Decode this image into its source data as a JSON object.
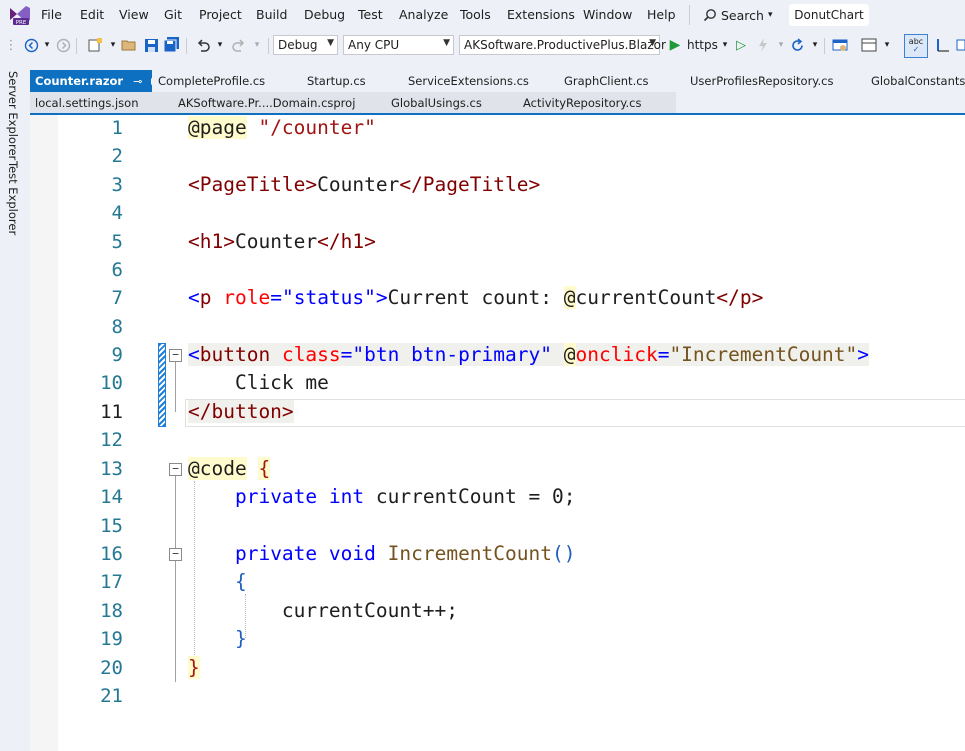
{
  "menubar": {
    "logo_badge": "PRE",
    "items": [
      "File",
      "Edit",
      "View",
      "Git",
      "Project",
      "Build",
      "Debug",
      "Test",
      "Analyze",
      "Tools",
      "Extensions",
      "Window",
      "Help"
    ],
    "search_label": "Search",
    "solution_name": "DonutChart"
  },
  "toolbar": {
    "config": "Debug",
    "platform": "Any CPU",
    "startup_project": "AKSoftware.ProductivePlus.Blazor",
    "run_label": "https"
  },
  "sidebar": {
    "items": [
      "Server Explorer",
      "Test Explorer"
    ]
  },
  "tabs": {
    "row1": [
      "Counter.razor",
      "CompleteProfile.cs",
      "Startup.cs",
      "ServiceExtensions.cs",
      "GraphClient.cs",
      "UserProfilesRepository.cs",
      "GlobalConstants.cs"
    ],
    "row2": [
      "local.settings.json",
      "AKSoftware.Pr....Domain.csproj",
      "GlobalUsings.cs",
      "ActivityRepository.cs"
    ],
    "active_pin": "⊸"
  },
  "editor": {
    "current_line": 11,
    "lines": [
      {
        "n": "1"
      },
      {
        "n": "2"
      },
      {
        "n": "3"
      },
      {
        "n": "4"
      },
      {
        "n": "5"
      },
      {
        "n": "6"
      },
      {
        "n": "7"
      },
      {
        "n": "8"
      },
      {
        "n": "9"
      },
      {
        "n": "10"
      },
      {
        "n": "11"
      },
      {
        "n": "12"
      },
      {
        "n": "13"
      },
      {
        "n": "14"
      },
      {
        "n": "15"
      },
      {
        "n": "16"
      },
      {
        "n": "17"
      },
      {
        "n": "18"
      },
      {
        "n": "19"
      },
      {
        "n": "20"
      },
      {
        "n": "21"
      }
    ],
    "tokens": {
      "l1_dir": "@page",
      "l1_str": "\"/counter\"",
      "l3_open": "<PageTitle>",
      "l3_text": "Counter",
      "l3_close": "</PageTitle>",
      "l5_open": "<h1>",
      "l5_text": "Counter",
      "l5_close": "</h1>",
      "l7_lt": "<",
      "l7_tag": "p",
      "l7_attr": "role",
      "l7_eq": "=",
      "l7_val": "\"status\"",
      "l7_gt": ">",
      "l7_text": "Current count: ",
      "l7_at": "@",
      "l7_var": "currentCount",
      "l7_close": "</p>",
      "l9_lt": "<",
      "l9_tag": "button",
      "l9_attr": "class",
      "l9_eq": "=",
      "l9_val": "\"btn btn-primary\"",
      "l9_at": "@",
      "l9_attr2": "onclick",
      "l9_eq2": "=",
      "l9_val2": "\"IncrementCount\"",
      "l9_gt": ">",
      "l10_text": "    Click me",
      "l11_close": "</button>",
      "l13_dir": "@code",
      "l13_brace": "{",
      "l14_indent": "    ",
      "l14_kw1": "private",
      "l14_kw2": "int",
      "l14_rest": " currentCount = 0;",
      "l16_indent": "    ",
      "l16_kw1": "private",
      "l16_kw2": "void",
      "l16_meth": "IncrementCount",
      "l16_parens": "()",
      "l17_brace": "    {",
      "l18_text": "        currentCount++;",
      "l19_brace": "    }",
      "l20_brace": "}"
    }
  }
}
